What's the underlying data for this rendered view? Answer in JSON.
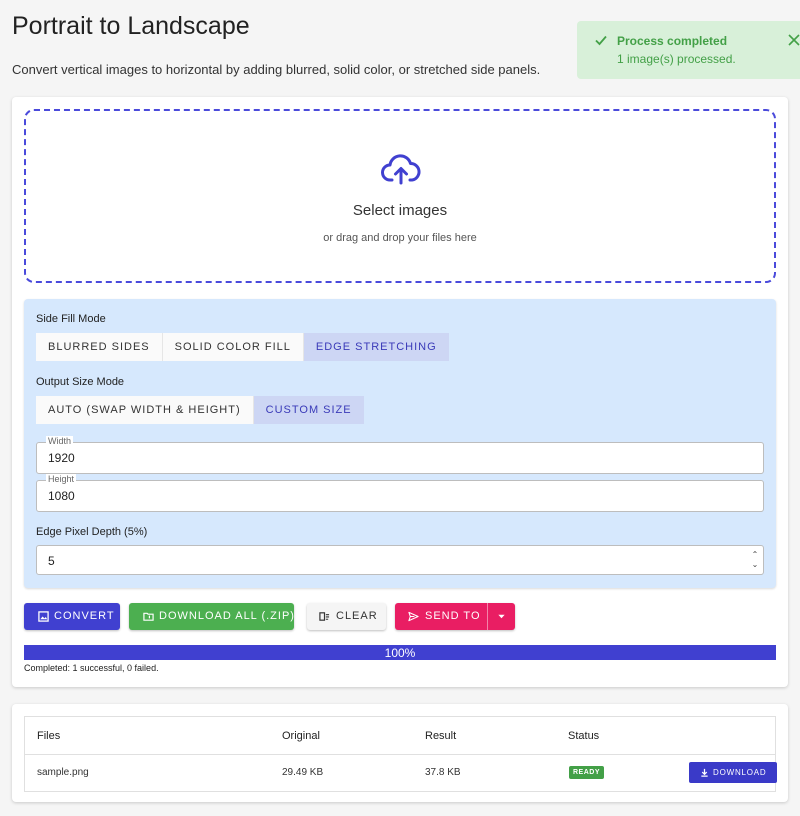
{
  "header": {
    "title": "Portrait to Landscape",
    "subtitle": "Convert vertical images to horizontal by adding blurred, solid color, or stretched side panels."
  },
  "toast": {
    "title": "Process completed",
    "message": "1 image(s) processed.",
    "color": "#43a047",
    "background": "#d8f0d9"
  },
  "dropzone": {
    "title": "Select images",
    "subtitle": "or drag and drop your files here",
    "icon": "cloud-upload-icon"
  },
  "settings": {
    "side_fill_label": "Side Fill Mode",
    "side_fill_options": [
      "Blurred Sides",
      "Solid Color Fill",
      "Edge Stretching"
    ],
    "side_fill_selected": "Edge Stretching",
    "output_size_label": "Output Size Mode",
    "output_size_options": [
      "Auto (Swap Width & Height)",
      "Custom Size"
    ],
    "output_size_selected": "Custom Size",
    "width_label": "Width",
    "width_value": "1920",
    "height_label": "Height",
    "height_value": "1080",
    "edge_depth_label": "Edge Pixel Depth (5%)",
    "edge_depth_value": "5"
  },
  "actions": {
    "convert": "Convert",
    "download_all": "Download All (.zip)",
    "clear": "Clear",
    "send_to": "Send To"
  },
  "progress": {
    "percent": 100,
    "label": "100%",
    "status": "Completed: 1 successful, 0 failed."
  },
  "results": {
    "headers": [
      "Files",
      "Original",
      "Result",
      "Status"
    ],
    "rows": [
      {
        "file": "sample.png",
        "original": "29.49 KB",
        "result": "37.8 KB",
        "status": "READY",
        "action": "Download"
      }
    ]
  },
  "colors": {
    "accent": "#4040d0",
    "success": "#43a047",
    "send": "#e91e63",
    "settings_bg": "#d6e8fd"
  }
}
